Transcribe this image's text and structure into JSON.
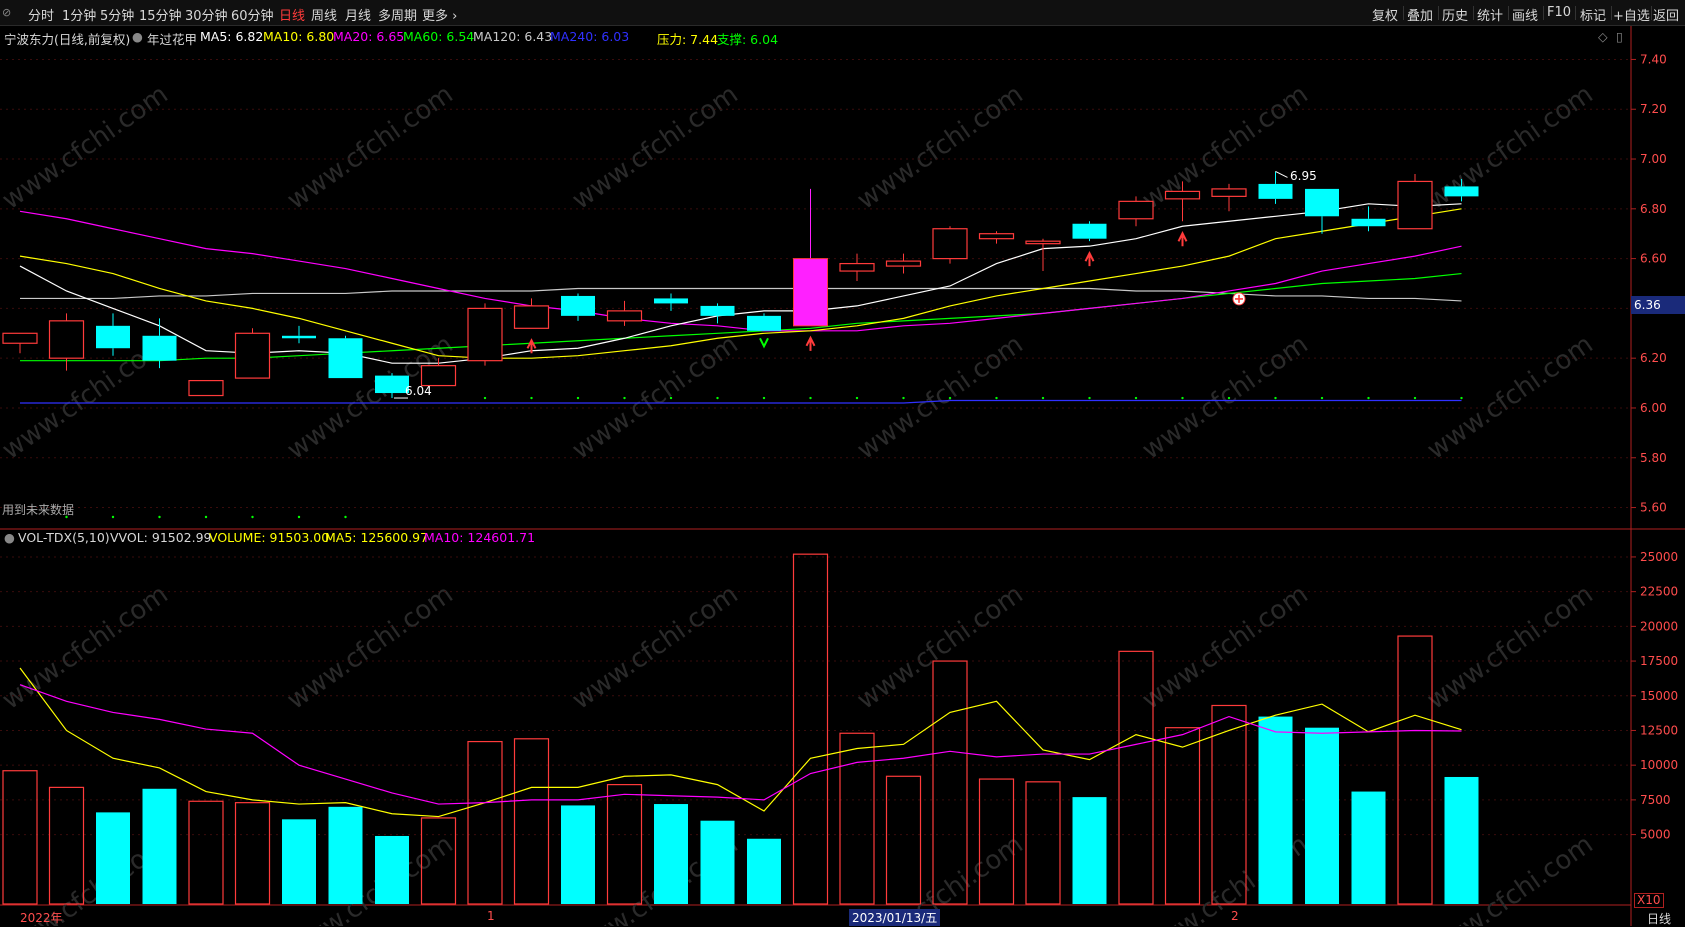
{
  "toolbar": {
    "periods": [
      "分时",
      "1分钟",
      "5分钟",
      "15分钟",
      "30分钟",
      "60分钟",
      "日线",
      "周线",
      "月线",
      "多周期",
      "更多 ›"
    ],
    "active_period": "日线",
    "right_tools": [
      "复权",
      "叠加",
      "历史",
      "统计",
      "画线",
      "F10",
      "标记",
      "+自选",
      "返回"
    ]
  },
  "main_info": {
    "stock": "宁波东力(日线,前复权)",
    "indicator": "年过花甲",
    "ma5": "MA5: 6.82",
    "ma10": "MA10: 6.80",
    "ma20": "MA20: 6.65",
    "ma60": "MA60: 6.54",
    "ma120": "MA120: 6.43",
    "ma240": "MA240: 6.03",
    "pressure": "压力: 7.44",
    "support": "支撑: 6.04"
  },
  "vol_info": {
    "name": "VOL-TDX(5,10)",
    "vvol": "VVOL: 91502.99",
    "volume": "VOLUME: 91503.00",
    "ma5": "MA5: 125600.97",
    "ma10": "MA10: 124601.71"
  },
  "notes": {
    "future_data": "用到未来数据",
    "high_label": "6.95",
    "low_label": "6.04",
    "current_price": "6.36",
    "x10": "X10",
    "period_tag": "日线",
    "watermark": "www.cfchi.com"
  },
  "price_axis": [
    "7.40",
    "7.20",
    "7.00",
    "6.80",
    "6.60",
    "6.40",
    "6.20",
    "6.00",
    "5.80",
    "5.60"
  ],
  "vol_axis": [
    "25000",
    "22500",
    "20000",
    "17500",
    "15000",
    "12500",
    "10000",
    "7500",
    "5000"
  ],
  "x_labels": [
    "2022年",
    "1",
    "2023/01/13/五",
    "2"
  ],
  "colors": {
    "up": "#ff3b3b",
    "down": "#00ffff",
    "ma5": "#ffffff",
    "ma10": "#ffff00",
    "ma20": "#ff00ff",
    "ma60": "#00ff00",
    "ma120": "#c8c8c8",
    "ma240": "#3030ff",
    "bg": "#000000"
  },
  "chart_data": {
    "type": "candlestick",
    "ohlc": [
      [
        6.26,
        6.3,
        6.22,
        6.3
      ],
      [
        6.2,
        6.38,
        6.15,
        6.35
      ],
      [
        6.33,
        6.38,
        6.21,
        6.24
      ],
      [
        6.29,
        6.36,
        6.16,
        6.19
      ],
      [
        6.05,
        6.11,
        6.05,
        6.11
      ],
      [
        6.12,
        6.32,
        6.12,
        6.3
      ],
      [
        6.29,
        6.33,
        6.26,
        6.28
      ],
      [
        6.28,
        6.29,
        6.12,
        6.12
      ],
      [
        6.13,
        6.14,
        6.04,
        6.06
      ],
      [
        6.09,
        6.2,
        6.09,
        6.17
      ],
      [
        6.19,
        6.42,
        6.17,
        6.4
      ],
      [
        6.32,
        6.44,
        6.32,
        6.41
      ],
      [
        6.45,
        6.46,
        6.35,
        6.37
      ],
      [
        6.35,
        6.43,
        6.33,
        6.39
      ],
      [
        6.44,
        6.46,
        6.39,
        6.42
      ],
      [
        6.41,
        6.42,
        6.34,
        6.37
      ],
      [
        6.37,
        6.38,
        6.32,
        6.31
      ],
      [
        6.33,
        6.88,
        6.33,
        6.6
      ],
      [
        6.55,
        6.62,
        6.51,
        6.58
      ],
      [
        6.57,
        6.62,
        6.54,
        6.59
      ],
      [
        6.6,
        6.73,
        6.58,
        6.72
      ],
      [
        6.68,
        6.71,
        6.66,
        6.7
      ],
      [
        6.66,
        6.68,
        6.55,
        6.67
      ],
      [
        6.74,
        6.75,
        6.67,
        6.68
      ],
      [
        6.76,
        6.85,
        6.73,
        6.83
      ],
      [
        6.84,
        6.91,
        6.75,
        6.87
      ],
      [
        6.85,
        6.9,
        6.79,
        6.88
      ],
      [
        6.9,
        6.95,
        6.82,
        6.84
      ],
      [
        6.88,
        6.88,
        6.7,
        6.77
      ],
      [
        6.76,
        6.81,
        6.71,
        6.73
      ],
      [
        6.72,
        6.94,
        6.72,
        6.91
      ],
      [
        6.89,
        6.92,
        6.83,
        6.85
      ]
    ],
    "ma5": [
      6.57,
      6.47,
      6.4,
      6.33,
      6.23,
      6.22,
      6.23,
      6.22,
      6.18,
      6.18,
      6.2,
      6.23,
      6.24,
      6.28,
      6.33,
      6.37,
      6.39,
      6.39,
      6.41,
      6.45,
      6.49,
      6.58,
      6.64,
      6.65,
      6.68,
      6.73,
      6.75,
      6.77,
      6.79,
      6.82,
      6.81,
      6.82
    ],
    "ma10": [
      6.61,
      6.58,
      6.54,
      6.48,
      6.43,
      6.4,
      6.36,
      6.31,
      6.26,
      6.21,
      6.2,
      6.2,
      6.21,
      6.23,
      6.25,
      6.28,
      6.3,
      6.31,
      6.33,
      6.36,
      6.41,
      6.45,
      6.48,
      6.51,
      6.54,
      6.57,
      6.61,
      6.68,
      6.71,
      6.74,
      6.77,
      6.8
    ],
    "ma20": [
      6.79,
      6.76,
      6.72,
      6.68,
      6.64,
      6.62,
      6.59,
      6.56,
      6.52,
      6.48,
      6.44,
      6.41,
      6.39,
      6.36,
      6.34,
      6.33,
      6.31,
      6.31,
      6.31,
      6.33,
      6.34,
      6.36,
      6.38,
      6.4,
      6.42,
      6.44,
      6.47,
      6.5,
      6.55,
      6.58,
      6.61,
      6.65
    ],
    "ma60": [
      6.19,
      6.19,
      6.19,
      6.19,
      6.2,
      6.2,
      6.21,
      6.22,
      6.23,
      6.24,
      6.25,
      6.26,
      6.27,
      6.28,
      6.29,
      6.3,
      6.31,
      6.32,
      6.34,
      6.35,
      6.36,
      6.37,
      6.38,
      6.4,
      6.42,
      6.44,
      6.46,
      6.48,
      6.5,
      6.51,
      6.52,
      6.54
    ],
    "ma120": [
      6.44,
      6.44,
      6.44,
      6.45,
      6.45,
      6.46,
      6.46,
      6.46,
      6.47,
      6.47,
      6.47,
      6.47,
      6.48,
      6.48,
      6.48,
      6.48,
      6.48,
      6.48,
      6.48,
      6.48,
      6.48,
      6.48,
      6.48,
      6.48,
      6.47,
      6.47,
      6.46,
      6.45,
      6.45,
      6.44,
      6.44,
      6.43
    ],
    "ma240": [
      6.02,
      6.02,
      6.02,
      6.02,
      6.02,
      6.02,
      6.02,
      6.02,
      6.02,
      6.02,
      6.02,
      6.02,
      6.02,
      6.02,
      6.02,
      6.02,
      6.02,
      6.02,
      6.02,
      6.02,
      6.03,
      6.03,
      6.03,
      6.03,
      6.03,
      6.03,
      6.03,
      6.03,
      6.03,
      6.03,
      6.03,
      6.03
    ],
    "volume": [
      9600,
      8400,
      6600,
      8300,
      7400,
      7300,
      6100,
      7000,
      4900,
      6200,
      11700,
      11900,
      7100,
      8600,
      7200,
      6000,
      4700,
      25200,
      12300,
      9200,
      17500,
      9000,
      8800,
      7700,
      18200,
      12700,
      14300,
      13500,
      12700,
      8100,
      19300,
      9150
    ],
    "vol_ma5": [
      17000,
      12500,
      10500,
      9800,
      8100,
      7500,
      7200,
      7300,
      6500,
      6300,
      7300,
      8400,
      8400,
      9200,
      9300,
      8600,
      6700,
      10500,
      11200,
      11500,
      13800,
      14600,
      11100,
      10400,
      12200,
      11300,
      12500,
      13600,
      14400,
      12400,
      13600,
      12560
    ],
    "vol_ma10": [
      15800,
      14600,
      13800,
      13300,
      12600,
      12300,
      10000,
      9000,
      8000,
      7200,
      7300,
      7500,
      7500,
      7900,
      7800,
      7700,
      7500,
      9400,
      10200,
      10500,
      11000,
      10600,
      10800,
      10800,
      11500,
      12200,
      13500,
      12400,
      12300,
      12400,
      12500,
      12460
    ],
    "up_arrows": [
      11,
      17,
      23,
      25
    ],
    "down_arrows": [
      16
    ],
    "price_ylim": [
      5.55,
      7.45
    ],
    "vol_ylim": [
      0,
      25500
    ]
  }
}
